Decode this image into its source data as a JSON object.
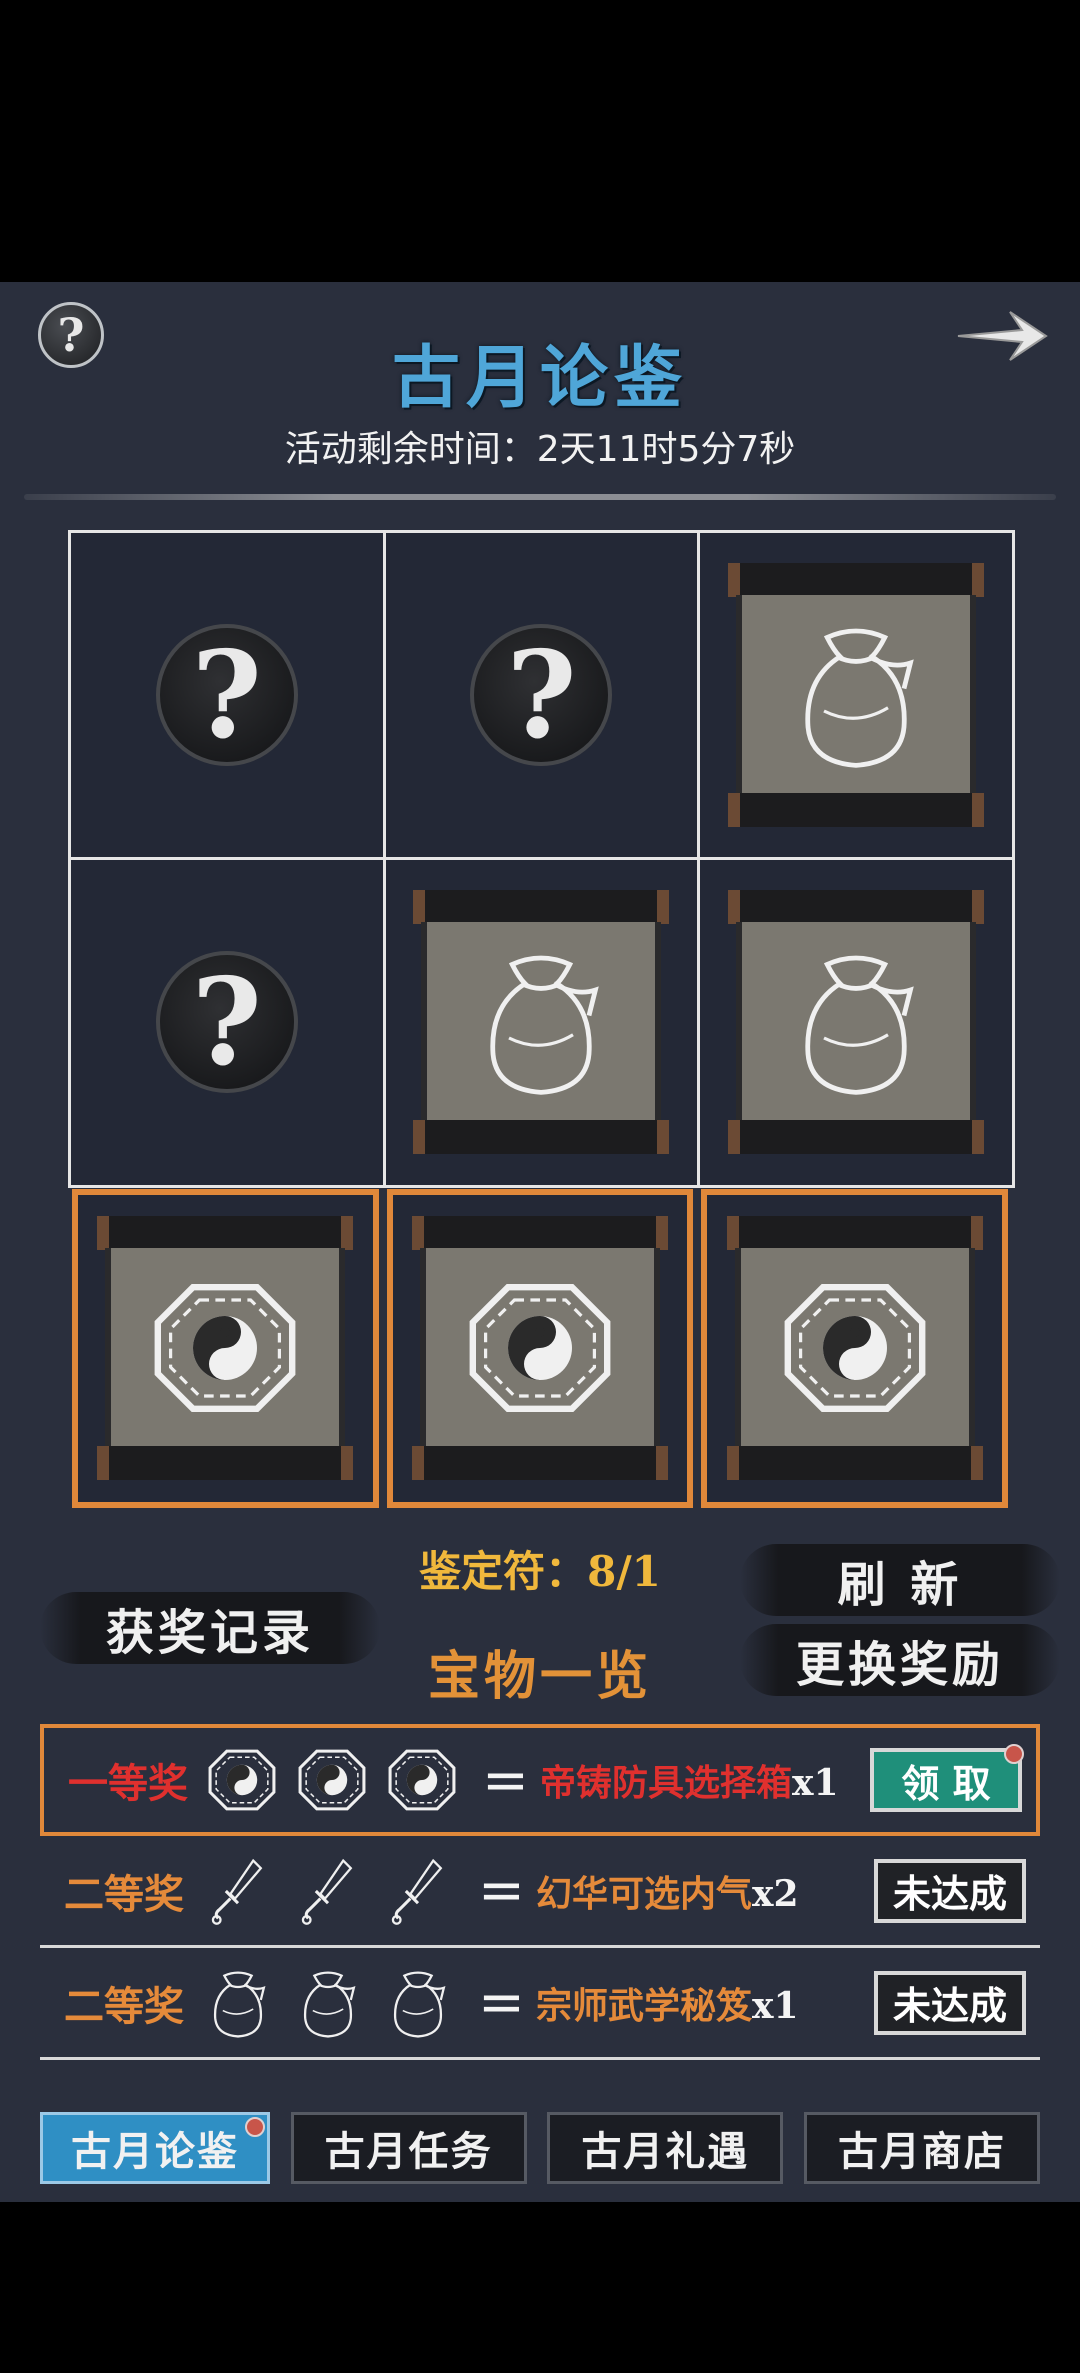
{
  "header": {
    "title": "古月论鉴",
    "countdown": "活动剩余时间：2天11时5分7秒"
  },
  "grid": [
    {
      "state": "unknown",
      "item": "question-icon",
      "winning": false
    },
    {
      "state": "unknown",
      "item": "question-icon",
      "winning": false
    },
    {
      "state": "revealed",
      "item": "pouch-icon",
      "winning": false
    },
    {
      "state": "unknown",
      "item": "question-icon",
      "winning": false
    },
    {
      "state": "revealed",
      "item": "pouch-icon",
      "winning": false
    },
    {
      "state": "revealed",
      "item": "pouch-icon",
      "winning": false
    },
    {
      "state": "revealed",
      "item": "bagua-icon",
      "winning": true
    },
    {
      "state": "revealed",
      "item": "bagua-icon",
      "winning": true
    },
    {
      "state": "revealed",
      "item": "bagua-icon",
      "winning": true
    }
  ],
  "token_line": "鉴定符：8/1",
  "actions": {
    "record": "获奖记录",
    "refresh": "刷 新",
    "change": "更换奖励",
    "treasure": "宝物一览"
  },
  "prizes": [
    {
      "label": "一等奖",
      "icon": "bagua-icon",
      "reward": "帝铸防具选择箱",
      "qty": "x1",
      "button": "领 取",
      "status": "claimable",
      "label_color": "#e0302e",
      "reward_color": "#e0302e"
    },
    {
      "label": "二等奖",
      "icon": "dagger-icon",
      "reward": "幻华可选内气",
      "qty": "x2",
      "button": "未达成",
      "status": "pending",
      "label_color": "#e58a3a",
      "reward_color": "#e58a3a"
    },
    {
      "label": "二等奖",
      "icon": "pouch-icon",
      "reward": "宗师武学秘笈",
      "qty": "x1",
      "button": "未达成",
      "status": "pending",
      "label_color": "#e58a3a",
      "reward_color": "#e58a3a"
    }
  ],
  "tabs": [
    {
      "label": "古月论鉴",
      "active": true
    },
    {
      "label": "古月任务",
      "active": false
    },
    {
      "label": "古月礼遇",
      "active": false
    },
    {
      "label": "古月商店",
      "active": false
    }
  ]
}
